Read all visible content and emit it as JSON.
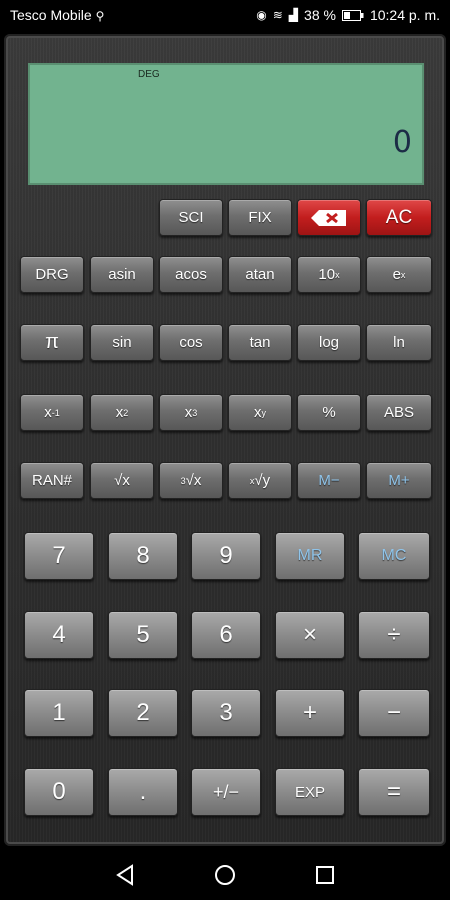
{
  "status": {
    "carrier": "Tesco Mobile",
    "battery": "38 %",
    "time": "10:24 p. m."
  },
  "display": {
    "mode": "DEG",
    "value": "0"
  },
  "keys": {
    "sci": "SCI",
    "fix": "FIX",
    "ac": "AC",
    "drg": "DRG",
    "asin": "asin",
    "acos": "acos",
    "atan": "atan",
    "pow10_base": "10",
    "pow10_exp": "x",
    "exp_base": "e",
    "exp_exp": "x",
    "pi": "π",
    "sin": "sin",
    "cos": "cos",
    "tan": "tan",
    "log": "log",
    "ln": "ln",
    "inv_base": "x",
    "inv_exp": "-1",
    "sq_base": "x",
    "sq_exp": "2",
    "cube_base": "x",
    "cube_exp": "3",
    "powy_base": "x",
    "powy_exp": "y",
    "percent": "%",
    "abs": "ABS",
    "ran": "RAN#",
    "sqrt": "√x",
    "cbrt_idx": "3",
    "cbrt": "√x",
    "yroot_idx": "x",
    "yroot": "√y",
    "m_minus": "M−",
    "m_plus": "M+",
    "seven": "7",
    "eight": "8",
    "nine": "9",
    "mr": "MR",
    "mc": "MC",
    "four": "4",
    "five": "5",
    "six": "6",
    "multiply": "×",
    "divide": "÷",
    "one": "1",
    "two": "2",
    "three": "3",
    "plus": "+",
    "minus": "−",
    "zero": "0",
    "dot": ".",
    "sign": "+/−",
    "exp": "EXP",
    "equals": "="
  }
}
